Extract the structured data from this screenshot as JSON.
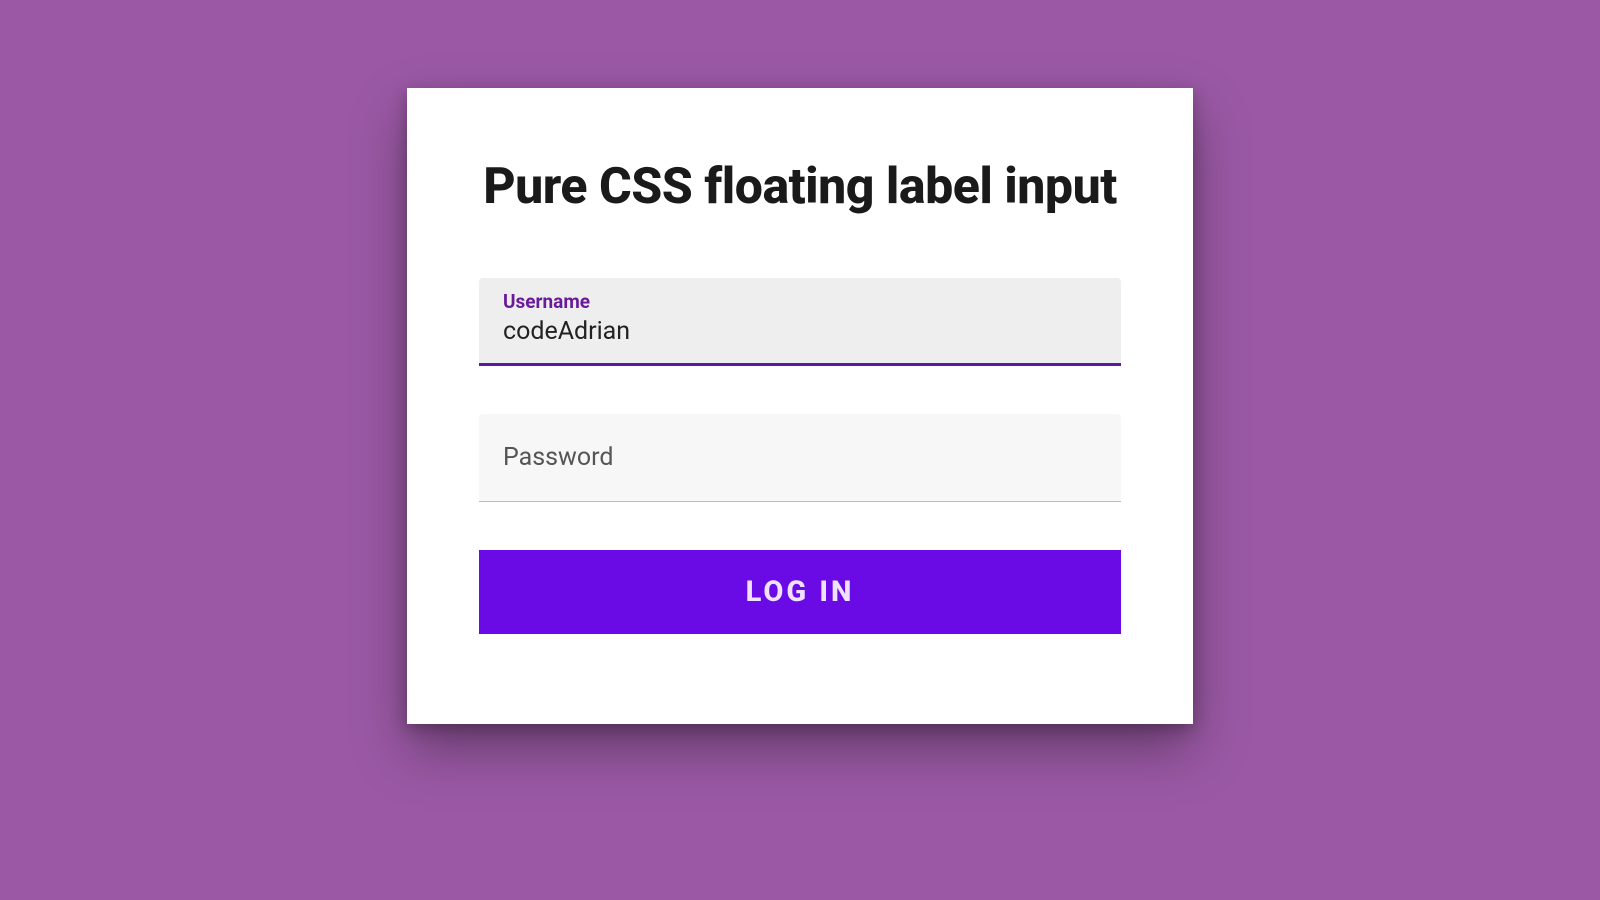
{
  "form": {
    "title": "Pure CSS floating label input",
    "username": {
      "label": "Username",
      "value": "codeAdrian"
    },
    "password": {
      "label": "Password",
      "value": ""
    },
    "submit_label": "LOG IN"
  },
  "colors": {
    "page_bg": "#9b59a5",
    "card_bg": "#ffffff",
    "accent": "#6a0be6",
    "float_label": "#6a1b9a",
    "input_bg_active": "#eeeeee",
    "input_bg_idle": "#f7f7f7"
  }
}
